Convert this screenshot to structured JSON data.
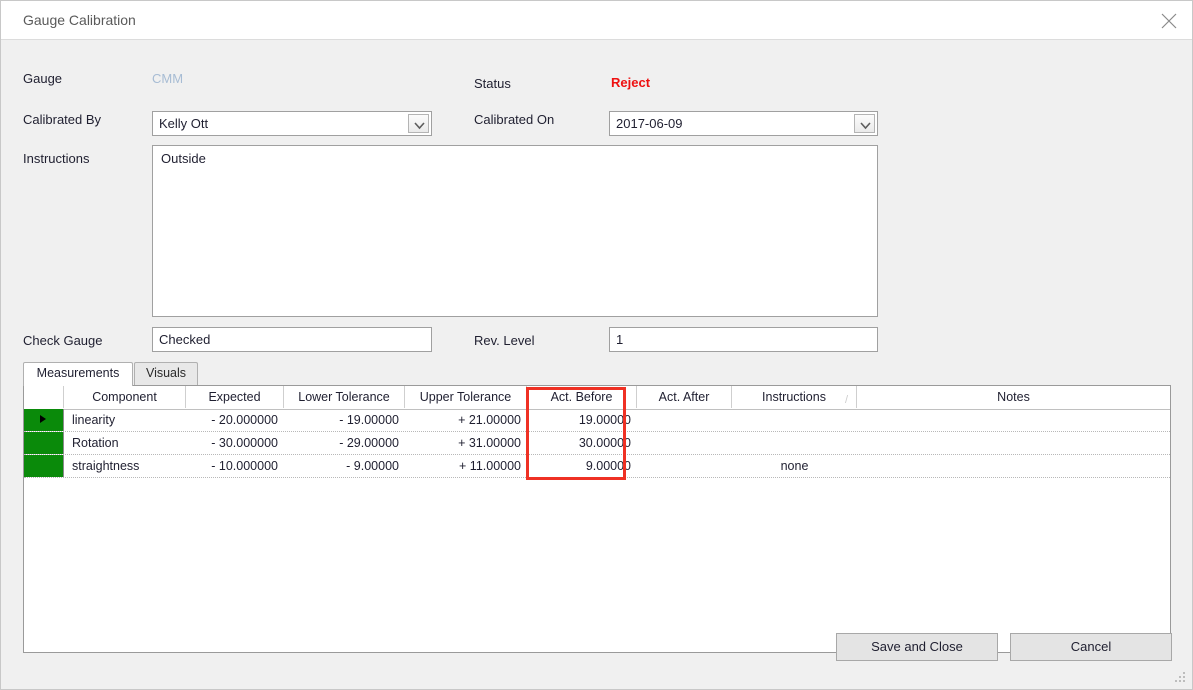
{
  "window": {
    "title": "Gauge Calibration",
    "close_icon": "close-icon"
  },
  "form": {
    "gauge_label": "Gauge",
    "gauge_value": "CMM",
    "status_label": "Status",
    "status_value": "Reject",
    "status_color": "#ee1111",
    "calibrated_by_label": "Calibrated By",
    "calibrated_by_value": "Kelly Ott",
    "calibrated_on_label": "Calibrated On",
    "calibrated_on_value": "2017-06-09",
    "instructions_label": "Instructions",
    "instructions_value": "Outside",
    "check_gauge_label": "Check Gauge",
    "check_gauge_value": "Checked",
    "rev_level_label": "Rev. Level",
    "rev_level_value": "1"
  },
  "tabs": [
    {
      "label": "Measurements",
      "active": true
    },
    {
      "label": "Visuals",
      "active": false
    }
  ],
  "grid": {
    "columns": [
      "Component",
      "Expected",
      "Lower Tolerance",
      "Upper Tolerance",
      "Act. Before",
      "Act. After",
      "Instructions",
      "Notes"
    ],
    "instructions_sort_glyph": "/",
    "highlight": {
      "column": "Act. Before",
      "color": "#ef3124"
    },
    "rows": [
      {
        "selected": true,
        "component": "linearity",
        "expected": "- 20.000000",
        "lower_tolerance": "- 19.00000",
        "upper_tolerance": "+ 21.00000",
        "act_before": "19.00000",
        "act_after": "",
        "instructions": "",
        "notes": ""
      },
      {
        "selected": false,
        "component": "Rotation",
        "expected": "- 30.000000",
        "lower_tolerance": "- 29.00000",
        "upper_tolerance": "+ 31.00000",
        "act_before": "30.00000",
        "act_after": "",
        "instructions": "",
        "notes": ""
      },
      {
        "selected": false,
        "component": "straightness",
        "expected": "- 10.000000",
        "lower_tolerance": "- 9.00000",
        "upper_tolerance": "+ 11.00000",
        "act_before": "9.00000",
        "act_after": "",
        "instructions": "none",
        "notes": ""
      }
    ]
  },
  "footer": {
    "save_label": "Save and Close",
    "cancel_label": "Cancel"
  }
}
